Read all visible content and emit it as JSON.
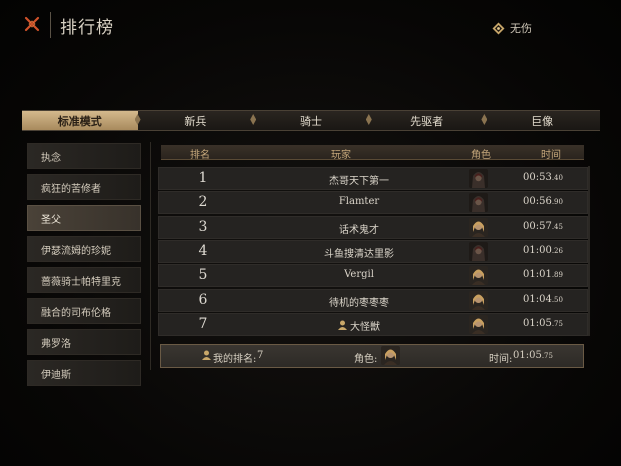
{
  "header": {
    "title": "排行榜",
    "flawless_label": "无伤"
  },
  "tabs": [
    {
      "label": "标准模式",
      "active": true
    },
    {
      "label": "新兵",
      "active": false
    },
    {
      "label": "骑士",
      "active": false
    },
    {
      "label": "先驱者",
      "active": false
    },
    {
      "label": "巨像",
      "active": false
    }
  ],
  "sidebar": {
    "items": [
      {
        "label": "执念",
        "active": false
      },
      {
        "label": "疯狂的苦修者",
        "active": false
      },
      {
        "label": "圣父",
        "active": true
      },
      {
        "label": "伊瑟流姆的珍妮",
        "active": false
      },
      {
        "label": "蔷薇骑士帕特里克",
        "active": false
      },
      {
        "label": "融合的司布伦格",
        "active": false
      },
      {
        "label": "弗罗洛",
        "active": false
      },
      {
        "label": "伊迪斯",
        "active": false
      }
    ]
  },
  "table": {
    "columns": {
      "rank": "排名",
      "player": "玩家",
      "role": "角色",
      "time": "时间"
    },
    "rows": [
      {
        "rank": "1",
        "player": "杰哥天下第一",
        "role": "dark-hood",
        "time_main": "00:53",
        "time_ms": ".40",
        "crown": false
      },
      {
        "rank": "2",
        "player": "Flamter",
        "role": "dark-hood",
        "time_main": "00:56",
        "time_ms": ".90",
        "crown": false
      },
      {
        "rank": "3",
        "player": "话术鬼才",
        "role": "blonde",
        "time_main": "00:57",
        "time_ms": ".45",
        "crown": false
      },
      {
        "rank": "4",
        "player": "斗鱼搜清达里影",
        "role": "dark-hood",
        "time_main": "01:00",
        "time_ms": ".26",
        "crown": false
      },
      {
        "rank": "5",
        "player": "Vergil",
        "role": "blonde",
        "time_main": "01:01",
        "time_ms": ".89",
        "crown": false
      },
      {
        "rank": "6",
        "player": "待机的枣枣枣",
        "role": "blonde",
        "time_main": "01:04",
        "time_ms": ".50",
        "crown": false
      },
      {
        "rank": "7",
        "player": "大怪獣",
        "role": "blonde",
        "time_main": "01:05",
        "time_ms": ".75",
        "crown": true
      }
    ]
  },
  "my_rank": {
    "rank_label": "我的排名:",
    "rank_value": "7",
    "role_label": "角色:",
    "time_label": "时间:",
    "time_main": "01:05",
    "time_ms": ".75"
  },
  "colors": {
    "accent_gold": "#c4a67a",
    "tab_active": "#d4b98d",
    "close_icon": "#d0522a"
  }
}
